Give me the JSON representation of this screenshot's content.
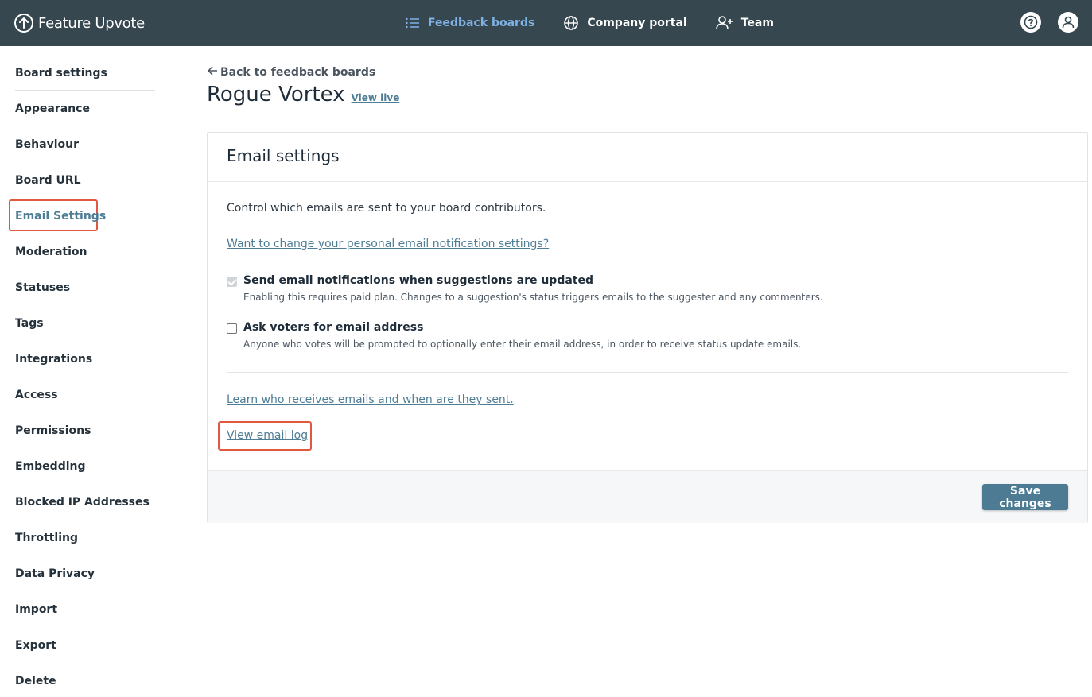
{
  "app": {
    "name": "Feature Upvote",
    "accent_color": "#4e7d96",
    "topbar_color": "#37474f"
  },
  "nav": {
    "items": [
      {
        "label": "Feedback boards",
        "icon": "list-icon",
        "active": true
      },
      {
        "label": "Company portal",
        "icon": "globe-icon",
        "active": false
      },
      {
        "label": "Team",
        "icon": "add-user-icon",
        "active": false
      }
    ],
    "help_icon": "help-icon",
    "account_icon": "user-icon"
  },
  "sidebar": {
    "items": [
      {
        "label": "Board settings"
      },
      {
        "label": "Appearance"
      },
      {
        "label": "Behaviour"
      },
      {
        "label": "Board URL"
      },
      {
        "label": "Email Settings",
        "active": true
      },
      {
        "label": "Moderation"
      },
      {
        "label": "Statuses"
      },
      {
        "label": "Tags"
      },
      {
        "label": "Integrations"
      },
      {
        "label": "Access"
      },
      {
        "label": "Permissions"
      },
      {
        "label": "Embedding"
      },
      {
        "label": "Blocked IP Addresses"
      },
      {
        "label": "Throttling"
      },
      {
        "label": "Data Privacy"
      },
      {
        "label": "Import"
      },
      {
        "label": "Export"
      },
      {
        "label": "Delete"
      }
    ]
  },
  "main": {
    "back_label": "Back to feedback boards",
    "board_name": "Rogue Vortex",
    "view_live_label": "View live",
    "card": {
      "title": "Email settings",
      "description": "Control which emails are sent to your board contributors.",
      "personal_link": "Want to change your personal email notification settings?",
      "options": [
        {
          "label": "Send email notifications when suggestions are updated",
          "help": "Enabling this requires paid plan. Changes to a suggestion's status triggers emails to the suggester and any commenters.",
          "checked": true,
          "disabled": true
        },
        {
          "label": "Ask voters for email address",
          "help": "Anyone who votes will be prompted to optionally enter their email address, in order to receive status update emails.",
          "checked": false,
          "disabled": false
        }
      ],
      "learn_link": "Learn who receives emails and when are they sent.",
      "log_link": "View email log",
      "save_label": "Save changes"
    }
  }
}
